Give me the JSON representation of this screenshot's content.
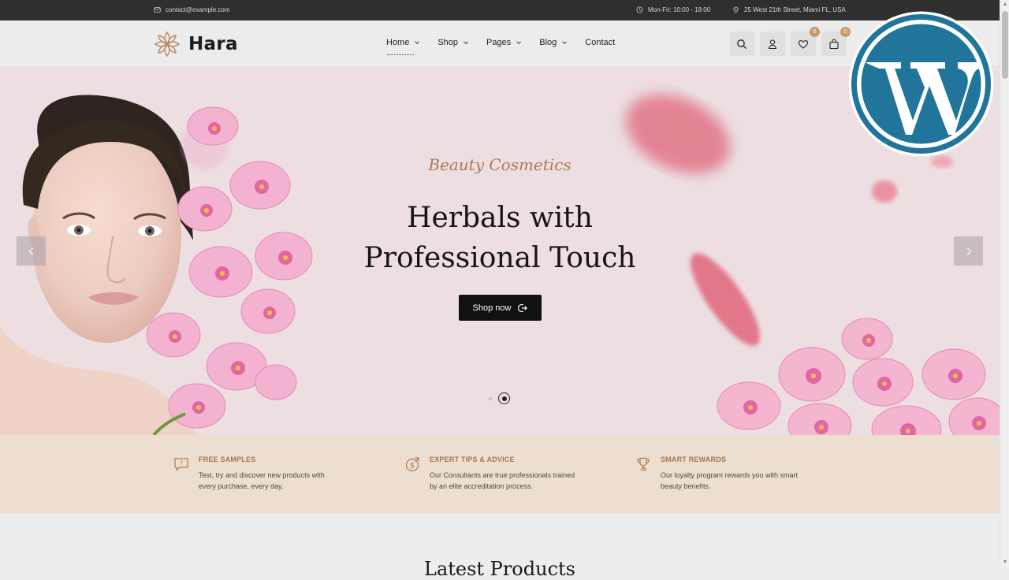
{
  "topbar": {
    "email": "contact@example.com",
    "hours": "Mon-Fri: 10:00 - 18:00",
    "address": "25 West 21th Street, Miami FL, USA"
  },
  "header": {
    "logo_text": "Hara",
    "nav": [
      {
        "label": "Home"
      },
      {
        "label": "Shop"
      },
      {
        "label": "Pages"
      },
      {
        "label": "Blog"
      },
      {
        "label": "Contact"
      }
    ],
    "wishlist_count": "0",
    "cart_count": "0"
  },
  "hero": {
    "subtitle": "Beauty Cosmetics",
    "title_line1": "Herbals with",
    "title_line2": "Professional Touch",
    "button_label": "Shop now"
  },
  "features": [
    {
      "title": "FREE SAMPLES",
      "line1": "Test, try and discover new products with",
      "line2": "every purchase, every day."
    },
    {
      "title": "EXPERT TIPS & ADVICE",
      "line1": "Our Consultants are true professionals trained",
      "line2": "by an elite accreditation process."
    },
    {
      "title": "SMART REWARDS",
      "line1": "Our loyalty program rewards you with smart",
      "line2": "beauty benefits."
    }
  ],
  "section_title": "Latest Products",
  "colors": {
    "accent": "#c99a6d",
    "feature_title": "#a8744a",
    "hero_bg": "#ecdee1",
    "features_bg": "#ecdfd2",
    "topbar_bg": "#2f2f2f",
    "wordpress_blue": "#21759b"
  }
}
